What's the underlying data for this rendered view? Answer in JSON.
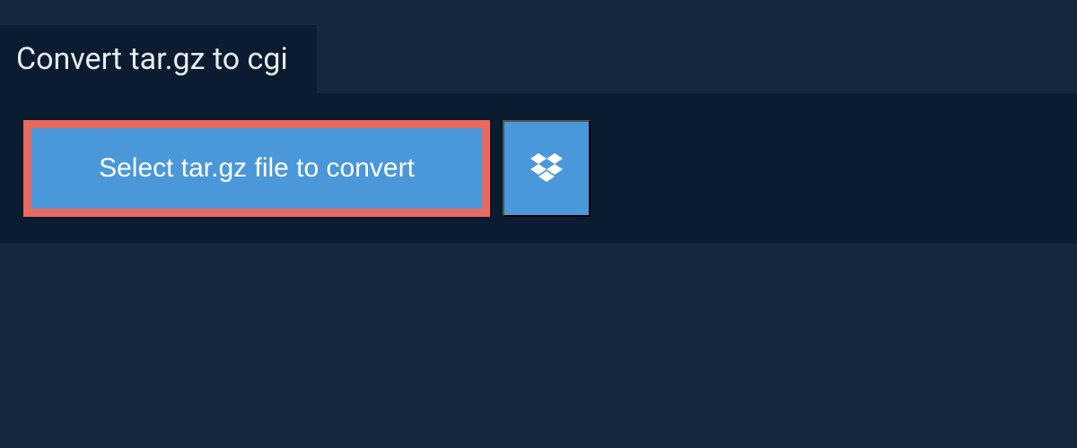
{
  "header": {
    "title": "Convert tar.gz to cgi"
  },
  "actions": {
    "select_file_label": "Select tar.gz file to convert"
  }
}
